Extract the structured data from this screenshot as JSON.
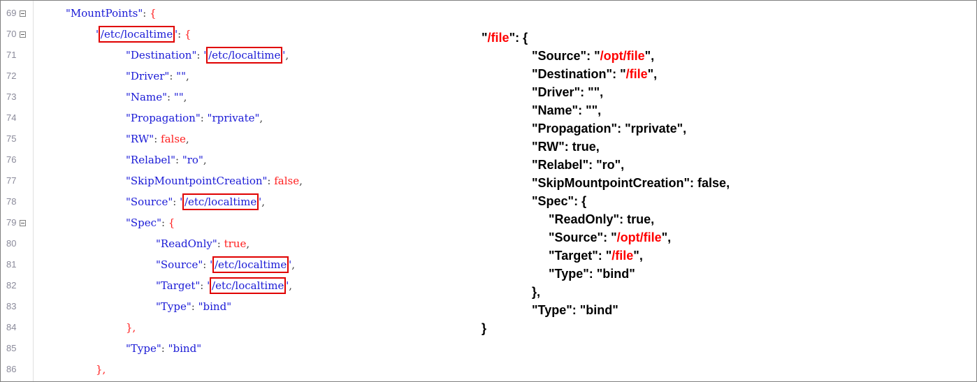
{
  "editor": {
    "lines": [
      {
        "num": "69",
        "foldable": true,
        "indent": 1,
        "key": "MountPoints",
        "value": "{",
        "value_type": "brace",
        "highlight": false
      },
      {
        "num": "70",
        "foldable": true,
        "indent": 2,
        "key": "/etc/localtime",
        "key_highlight": true,
        "value": "{",
        "value_type": "brace"
      },
      {
        "num": "71",
        "foldable": false,
        "indent": 3,
        "key": "Destination",
        "value": "/etc/localtime",
        "value_type": "string",
        "highlight": true,
        "trail": ","
      },
      {
        "num": "72",
        "foldable": false,
        "indent": 3,
        "key": "Driver",
        "value": "",
        "value_type": "string",
        "trail": ","
      },
      {
        "num": "73",
        "foldable": false,
        "indent": 3,
        "key": "Name",
        "value": "",
        "value_type": "string",
        "trail": ","
      },
      {
        "num": "74",
        "foldable": false,
        "indent": 3,
        "key": "Propagation",
        "value": "rprivate",
        "value_type": "string",
        "trail": ","
      },
      {
        "num": "75",
        "foldable": false,
        "indent": 3,
        "key": "RW",
        "value": "false",
        "value_type": "keyword",
        "trail": ","
      },
      {
        "num": "76",
        "foldable": false,
        "indent": 3,
        "key": "Relabel",
        "value": "ro",
        "value_type": "string",
        "trail": ","
      },
      {
        "num": "77",
        "foldable": false,
        "indent": 3,
        "key": "SkipMountpointCreation",
        "value": "false",
        "value_type": "keyword",
        "trail": ","
      },
      {
        "num": "78",
        "foldable": false,
        "indent": 3,
        "key": "Source",
        "value": "/etc/localtime",
        "value_type": "string",
        "highlight": true,
        "trail": ","
      },
      {
        "num": "79",
        "foldable": true,
        "indent": 3,
        "key": "Spec",
        "value": "{",
        "value_type": "brace"
      },
      {
        "num": "80",
        "foldable": false,
        "indent": 4,
        "key": "ReadOnly",
        "value": "true",
        "value_type": "keyword",
        "trail": ","
      },
      {
        "num": "81",
        "foldable": false,
        "indent": 4,
        "key": "Source",
        "value": "/etc/localtime",
        "value_type": "string",
        "highlight": true,
        "trail": ","
      },
      {
        "num": "82",
        "foldable": false,
        "indent": 4,
        "key": "Target",
        "value": "/etc/localtime",
        "value_type": "string",
        "highlight": true,
        "trail": ","
      },
      {
        "num": "83",
        "foldable": false,
        "indent": 4,
        "key": "Type",
        "value": "bind",
        "value_type": "string"
      },
      {
        "num": "84",
        "foldable": false,
        "indent": 3,
        "text": "},",
        "value_type": "close"
      },
      {
        "num": "85",
        "foldable": false,
        "indent": 3,
        "key": "Type",
        "value": "bind",
        "value_type": "string"
      },
      {
        "num": "86",
        "foldable": false,
        "indent": 2,
        "text": "},",
        "value_type": "close"
      }
    ]
  },
  "annotation": {
    "lines": [
      {
        "indent": 0,
        "parts": [
          {
            "t": "\"",
            "c": "k"
          },
          {
            "t": "/file",
            "c": "r"
          },
          {
            "t": "\": {",
            "c": "k"
          }
        ]
      },
      {
        "indent": 1,
        "parts": [
          {
            "t": "\"Source\": \"",
            "c": "k"
          },
          {
            "t": "/opt/file",
            "c": "r"
          },
          {
            "t": "\",",
            "c": "k"
          }
        ]
      },
      {
        "indent": 1,
        "parts": [
          {
            "t": "\"Destination\": \"",
            "c": "k"
          },
          {
            "t": "/file",
            "c": "r"
          },
          {
            "t": "\",",
            "c": "k"
          }
        ]
      },
      {
        "indent": 1,
        "parts": [
          {
            "t": "\"Driver\": \"\",",
            "c": "k"
          }
        ]
      },
      {
        "indent": 1,
        "parts": [
          {
            "t": "\"Name\": \"\",",
            "c": "k"
          }
        ]
      },
      {
        "indent": 1,
        "parts": [
          {
            "t": "\"Propagation\": \"rprivate\",",
            "c": "k"
          }
        ]
      },
      {
        "indent": 1,
        "parts": [
          {
            "t": "\"RW\": true,",
            "c": "k"
          }
        ]
      },
      {
        "indent": 1,
        "parts": [
          {
            "t": "\"Relabel\": \"ro\",",
            "c": "k"
          }
        ]
      },
      {
        "indent": 1,
        "parts": [
          {
            "t": "\"SkipMountpointCreation\": false,",
            "c": "k"
          }
        ]
      },
      {
        "indent": 1,
        "parts": [
          {
            "t": "\"Spec\": {",
            "c": "k"
          }
        ]
      },
      {
        "indent": 2,
        "parts": [
          {
            "t": "\"ReadOnly\": true,",
            "c": "k"
          }
        ]
      },
      {
        "indent": 2,
        "parts": [
          {
            "t": "\"Source\": \"",
            "c": "k"
          },
          {
            "t": "/opt/file",
            "c": "r"
          },
          {
            "t": "\",",
            "c": "k"
          }
        ]
      },
      {
        "indent": 2,
        "parts": [
          {
            "t": "\"Target\": \"",
            "c": "k"
          },
          {
            "t": "/file",
            "c": "r"
          },
          {
            "t": "\",",
            "c": "k"
          }
        ]
      },
      {
        "indent": 2,
        "parts": [
          {
            "t": "\"Type\": \"bind\"",
            "c": "k"
          }
        ]
      },
      {
        "indent": 1,
        "parts": [
          {
            "t": "},",
            "c": "k"
          }
        ]
      },
      {
        "indent": 1,
        "parts": [
          {
            "t": "\"Type\": \"bind\"",
            "c": "k"
          }
        ]
      },
      {
        "indent": 0,
        "parts": [
          {
            "t": "}",
            "c": "k"
          }
        ]
      }
    ]
  }
}
